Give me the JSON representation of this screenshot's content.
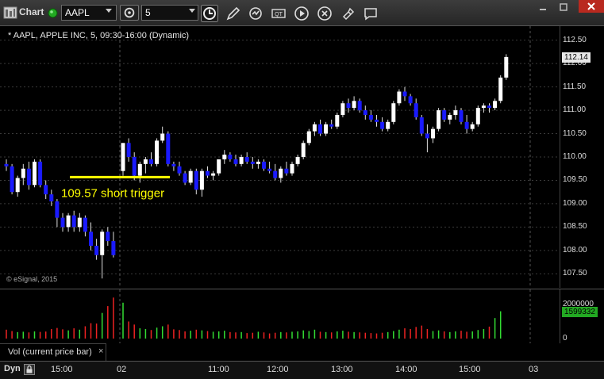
{
  "toolbar": {
    "title": "Chart",
    "symbol": "AAPL",
    "interval": "5",
    "icons": [
      "app-menu-icon",
      "status-dot-icon",
      "interval-settings-icon",
      "clock-icon",
      "pencil-icon",
      "refresh-icon",
      "quote-icon",
      "play-icon",
      "link-icon",
      "pin-icon",
      "chat-icon"
    ]
  },
  "window_buttons": [
    "minimize-icon",
    "restore-icon",
    "close-icon"
  ],
  "chart": {
    "label": "* AAPL, APPLE INC, 5, 09:30-16:00 (Dynamic)",
    "copyright": "© eSignal, 2015",
    "annotation": "109.57 short trigger",
    "annotation_color": "#ffff00",
    "current_price": "112.14",
    "current_volume": "1599332",
    "volume_label": "Vol (current price bar)",
    "volume_close": "×",
    "dyn_label": "Dyn",
    "colors": {
      "up": "#ffffff",
      "down": "#1a1aff",
      "vol_up": "#33dd33",
      "vol_down": "#ee2222",
      "badge_green": "#22aa22",
      "grid": "#3a3a3a"
    }
  },
  "chart_data": {
    "type": "candlestick",
    "title": "* AAPL, APPLE INC, 5, 09:30-16:00 (Dynamic)",
    "price_axis": {
      "ticks": [
        "112.50",
        "112.00",
        "111.50",
        "111.00",
        "110.50",
        "110.00",
        "109.50",
        "109.00",
        "108.50",
        "108.00",
        "107.50"
      ],
      "ylim": [
        107.2,
        112.8
      ]
    },
    "volume_axis": {
      "ticks": [
        "2000000",
        "0"
      ],
      "ylim": [
        0,
        2600000
      ]
    },
    "time_axis": {
      "ticks": [
        "15:00",
        "02",
        "11:00",
        "12:00",
        "13:00",
        "14:00",
        "15:00",
        "03"
      ]
    },
    "short_trigger_level": 109.57,
    "candles": [
      [
        109.85,
        109.95,
        109.7,
        109.8
      ],
      [
        109.8,
        109.85,
        109.2,
        109.25
      ],
      [
        109.25,
        109.6,
        109.15,
        109.55
      ],
      [
        109.55,
        109.85,
        109.4,
        109.75
      ],
      [
        109.75,
        109.9,
        109.3,
        109.4
      ],
      [
        109.4,
        109.95,
        109.35,
        109.9
      ],
      [
        109.9,
        109.95,
        109.35,
        109.4
      ],
      [
        109.4,
        109.5,
        109.1,
        109.2
      ],
      [
        109.2,
        109.3,
        108.95,
        109.05
      ],
      [
        109.05,
        109.1,
        108.5,
        108.7
      ],
      [
        108.7,
        108.8,
        108.4,
        108.5
      ],
      [
        108.5,
        108.8,
        108.4,
        108.75
      ],
      [
        108.75,
        108.85,
        108.4,
        108.5
      ],
      [
        108.5,
        108.8,
        108.4,
        108.7
      ],
      [
        108.7,
        108.75,
        108.3,
        108.4
      ],
      [
        108.4,
        108.6,
        108.0,
        108.1
      ],
      [
        108.1,
        108.25,
        107.8,
        107.9
      ],
      [
        107.9,
        108.45,
        107.4,
        108.4
      ],
      [
        108.4,
        108.5,
        108.1,
        108.2
      ],
      [
        108.2,
        108.4,
        107.85,
        107.9
      ],
      [
        109.7,
        110.3,
        109.6,
        110.3
      ],
      [
        110.3,
        110.4,
        109.9,
        110.0
      ],
      [
        110.0,
        110.1,
        109.5,
        109.6
      ],
      [
        109.6,
        109.9,
        109.45,
        109.85
      ],
      [
        109.85,
        110.0,
        109.65,
        109.95
      ],
      [
        109.95,
        110.1,
        109.8,
        109.85
      ],
      [
        109.85,
        110.4,
        109.8,
        110.35
      ],
      [
        110.35,
        110.65,
        110.3,
        110.5
      ],
      [
        110.5,
        110.55,
        109.8,
        109.85
      ],
      [
        109.85,
        109.9,
        109.7,
        109.8
      ],
      [
        109.8,
        109.9,
        109.6,
        109.65
      ],
      [
        109.65,
        109.7,
        109.4,
        109.45
      ],
      [
        109.45,
        109.75,
        109.4,
        109.7
      ],
      [
        109.7,
        109.75,
        109.2,
        109.3
      ],
      [
        109.3,
        109.75,
        109.15,
        109.7
      ],
      [
        109.7,
        109.8,
        109.55,
        109.6
      ],
      [
        109.6,
        109.7,
        109.5,
        109.65
      ],
      [
        109.65,
        109.95,
        109.6,
        109.95
      ],
      [
        109.95,
        110.15,
        109.85,
        110.05
      ],
      [
        110.05,
        110.1,
        109.9,
        109.95
      ],
      [
        109.95,
        110.05,
        109.8,
        109.85
      ],
      [
        109.85,
        110.05,
        109.8,
        110.0
      ],
      [
        110.0,
        110.1,
        109.85,
        109.9
      ],
      [
        109.9,
        110.0,
        109.75,
        109.85
      ],
      [
        109.85,
        109.95,
        109.75,
        109.9
      ],
      [
        109.9,
        109.95,
        109.7,
        109.75
      ],
      [
        109.75,
        109.9,
        109.65,
        109.7
      ],
      [
        109.7,
        109.85,
        109.5,
        109.55
      ],
      [
        109.55,
        109.8,
        109.45,
        109.75
      ],
      [
        109.75,
        109.9,
        109.6,
        109.65
      ],
      [
        109.65,
        109.9,
        109.6,
        109.85
      ],
      [
        109.85,
        110.05,
        109.8,
        110.0
      ],
      [
        110.0,
        110.35,
        109.95,
        110.3
      ],
      [
        110.3,
        110.6,
        110.25,
        110.55
      ],
      [
        110.55,
        110.75,
        110.45,
        110.7
      ],
      [
        110.7,
        110.8,
        110.45,
        110.5
      ],
      [
        110.5,
        110.75,
        110.45,
        110.7
      ],
      [
        110.7,
        110.8,
        110.6,
        110.65
      ],
      [
        110.65,
        110.95,
        110.6,
        110.9
      ],
      [
        110.9,
        111.2,
        110.85,
        111.15
      ],
      [
        111.15,
        111.25,
        110.95,
        111.05
      ],
      [
        111.05,
        111.3,
        111.0,
        111.2
      ],
      [
        111.2,
        111.25,
        110.95,
        111.0
      ],
      [
        111.0,
        111.1,
        110.8,
        110.9
      ],
      [
        110.9,
        111.0,
        110.75,
        110.8
      ],
      [
        110.8,
        110.9,
        110.65,
        110.75
      ],
      [
        110.75,
        110.85,
        110.55,
        110.6
      ],
      [
        110.6,
        110.8,
        110.55,
        110.75
      ],
      [
        110.75,
        111.2,
        110.7,
        111.15
      ],
      [
        111.15,
        111.45,
        111.1,
        111.4
      ],
      [
        111.4,
        111.5,
        111.2,
        111.3
      ],
      [
        111.3,
        111.35,
        111.1,
        111.15
      ],
      [
        111.15,
        111.25,
        110.8,
        110.85
      ],
      [
        110.85,
        110.9,
        110.45,
        110.5
      ],
      [
        110.5,
        110.7,
        110.1,
        110.4
      ],
      [
        110.4,
        110.65,
        110.3,
        110.6
      ],
      [
        110.6,
        111.05,
        110.55,
        111.0
      ],
      [
        111.0,
        111.05,
        110.75,
        110.8
      ],
      [
        110.8,
        110.95,
        110.7,
        110.9
      ],
      [
        110.9,
        111.1,
        110.8,
        111.0
      ],
      [
        111.0,
        111.05,
        110.7,
        110.75
      ],
      [
        110.75,
        110.9,
        110.5,
        110.6
      ],
      [
        110.6,
        110.75,
        110.55,
        110.7
      ],
      [
        110.7,
        111.1,
        110.65,
        111.05
      ],
      [
        111.05,
        111.15,
        110.95,
        111.1
      ],
      [
        111.1,
        111.15,
        110.95,
        111.05
      ],
      [
        111.05,
        111.25,
        111.0,
        111.2
      ],
      [
        111.2,
        111.75,
        111.15,
        111.7
      ],
      [
        111.7,
        112.2,
        111.65,
        112.14
      ]
    ],
    "volumes": [
      520000,
      440000,
      380000,
      400000,
      360000,
      420000,
      390000,
      410000,
      560000,
      620000,
      540000,
      480000,
      600000,
      520000,
      720000,
      900000,
      880000,
      1500000,
      1900000,
      2400000,
      2100000,
      1000000,
      820000,
      600000,
      560000,
      500000,
      640000,
      720000,
      820000,
      540000,
      500000,
      420000,
      460000,
      520000,
      480000,
      440000,
      400000,
      420000,
      460000,
      380000,
      360000,
      380000,
      320000,
      340000,
      400000,
      360000,
      300000,
      340000,
      380000,
      360000,
      400000,
      420000,
      480000,
      440000,
      520000,
      400000,
      380000,
      360000,
      420000,
      460000,
      400000,
      380000,
      360000,
      340000,
      320000,
      300000,
      340000,
      380000,
      440000,
      520000,
      600000,
      560000,
      680000,
      760000,
      560000,
      440000,
      480000,
      420000,
      380000,
      420000,
      460000,
      400000,
      420000,
      500000,
      560000,
      700000,
      1200000,
      1599332
    ]
  }
}
